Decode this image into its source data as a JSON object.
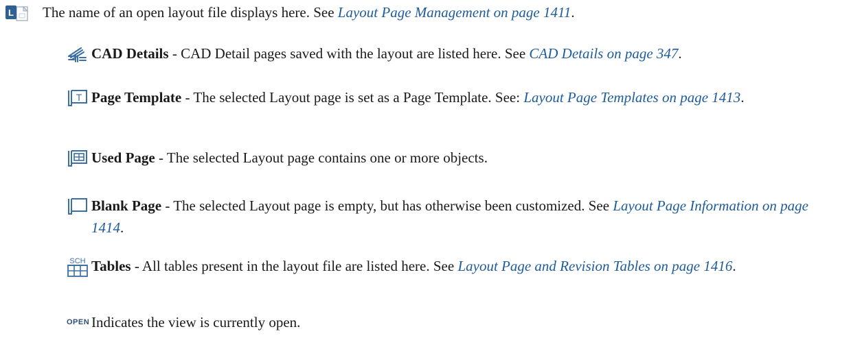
{
  "colors": {
    "text": "#1a1a1a",
    "link": "#1e5b9a",
    "icon_blue": "#3a6ea5"
  },
  "entries": [
    {
      "icon": "layout-file-icon",
      "before": "The name of an open layout file displays here. See ",
      "link": "Layout Page Management on page 1411",
      "after": "."
    },
    {
      "icon": "cad-details-icon",
      "term": "CAD Details",
      "before": " - CAD Detail pages saved with the layout are listed here. See ",
      "link": "CAD Details on page 347",
      "after": "."
    },
    {
      "icon": "page-template-icon",
      "term": "Page Template",
      "before": " - The selected Layout page is set as a Page Template. See: ",
      "link": "Layout Page Templates on page 1413",
      "after": "."
    },
    {
      "icon": "used-page-icon",
      "term": "Used Page",
      "before": " - The selected Layout page contains one or more objects."
    },
    {
      "icon": "blank-page-icon",
      "term": "Blank Page",
      "before": " - The selected Layout page is empty, but has otherwise been customized. See ",
      "link": "Layout Page Information on page 1414",
      "after": "."
    },
    {
      "icon": "tables-icon",
      "term": "Tables",
      "before": " - All tables present in the layout file are listed here. See ",
      "link": "Layout Page and Revision Tables on page 1416",
      "after": ".",
      "icon_text": "SCH"
    },
    {
      "icon": "open-indicator-icon",
      "icon_text": "OPEN",
      "before": "Indicates the view is currently open."
    }
  ]
}
